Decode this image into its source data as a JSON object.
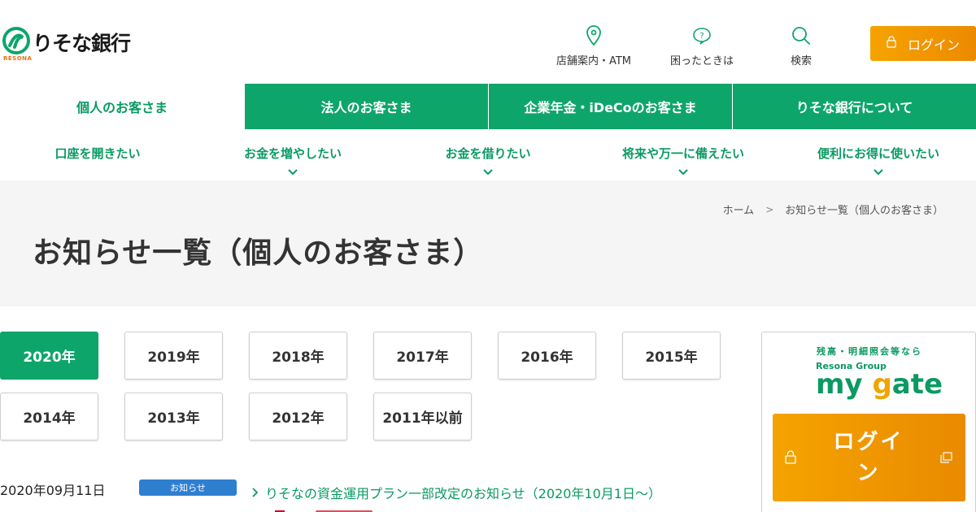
{
  "header": {
    "logo_text": "りそな銀行",
    "logo_sub": "RESONA",
    "utilities": [
      {
        "label": "店舗案内・ATM",
        "icon": "map-pin-icon"
      },
      {
        "label": "困ったときは",
        "icon": "help-bubble-icon"
      },
      {
        "label": "検索",
        "icon": "search-icon"
      }
    ],
    "login_label": "ログイン"
  },
  "main_nav": [
    {
      "label": "個人のお客さま",
      "active": true
    },
    {
      "label": "法人のお客さま"
    },
    {
      "label": "企業年金・iDeCoのお客さま"
    },
    {
      "label": "りそな銀行について"
    }
  ],
  "sub_nav": [
    {
      "label": "口座を開きたい"
    },
    {
      "label": "お金を増やしたい"
    },
    {
      "label": "お金を借りたい"
    },
    {
      "label": "将来や万一に備えたい"
    },
    {
      "label": "便利にお得に使いたい"
    }
  ],
  "breadcrumb": {
    "home": "ホーム",
    "current": "お知らせ一覧（個人のお客さま）"
  },
  "page_title": "お知らせ一覧（個人のお客さま）",
  "years": [
    "2020年",
    "2019年",
    "2018年",
    "2017年",
    "2016年",
    "2015年",
    "2014年",
    "2013年",
    "2012年",
    "2011年以前"
  ],
  "active_year": "2020年",
  "news": [
    {
      "date": "2020年09月11日",
      "tag": "お知らせ",
      "title": "りそなの資金運用プラン一部改定のお知らせ（2020年10月1日～）"
    }
  ],
  "side_panel": {
    "subtitle": "残高・明細照会等なら",
    "group": "Resona Group",
    "brand_a": "my ",
    "brand_g": "g",
    "brand_b": "ate",
    "login_label": "ログイン"
  },
  "colors": {
    "green": "#0ea56b",
    "orange": "#f5a300",
    "blue": "#2f7fd0"
  }
}
